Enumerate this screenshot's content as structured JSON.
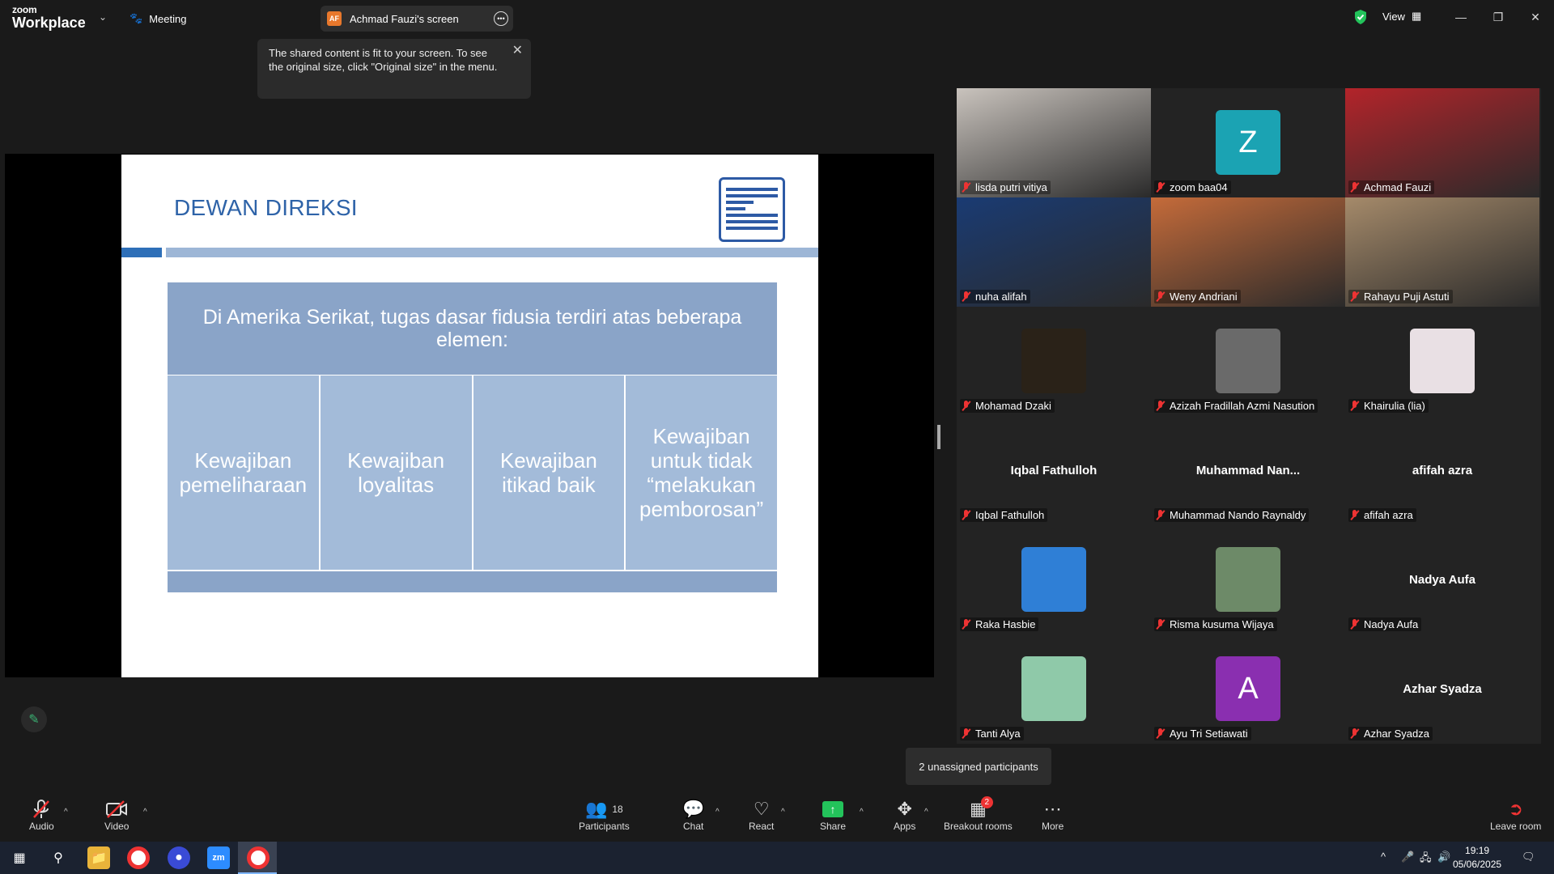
{
  "topbar": {
    "logo_small": "zoom",
    "logo_big": "Workplace",
    "meeting_label": "Meeting",
    "screen_badge": "AF",
    "screen_label": "Achmad Fauzi's screen",
    "view_label": "View"
  },
  "tooltip": {
    "text": "The shared content is fit to your screen. To see the original size, click \"Original size\" in the menu."
  },
  "slide": {
    "title": "DEWAN DIREKSI",
    "heading": "Di Amerika Serikat, tugas dasar fidusia terdiri atas beberapa elemen:",
    "columns": [
      "Kewajiban pemeliharaan",
      "Kewajiban loyalitas",
      "Kewajiban itikad baik",
      "Kewajiban untuk tidak “melakukan pemborosan”"
    ]
  },
  "gallery": {
    "participants": [
      {
        "name": "lisda putri vitiya",
        "type": "photo",
        "color": "#c9c3bd"
      },
      {
        "name": "zoom baa04",
        "type": "avatar",
        "initial": "Z",
        "color": "#1ba3b3"
      },
      {
        "name": "Achmad Fauzi",
        "type": "photo",
        "color": "#b3242a",
        "active": true
      },
      {
        "name": "nuha alifah",
        "type": "photo",
        "color": "#1a3b73"
      },
      {
        "name": "Weny Andriani",
        "type": "photo",
        "color": "#c56b3a"
      },
      {
        "name": "Rahayu Puji Astuti",
        "type": "photo",
        "color": "#a58a6a"
      },
      {
        "name": "Mohamad Dzaki",
        "type": "avatar-photo",
        "color": "#2a2218"
      },
      {
        "name": "Azizah Fradillah Azmi Nasution",
        "type": "avatar-photo",
        "color": "#6a6a6a"
      },
      {
        "name": "Khairulia (lia)",
        "type": "avatar-photo",
        "color": "#e9e0e4"
      },
      {
        "name": "Iqbal Fathulloh",
        "type": "name",
        "display": "Iqbal Fathulloh"
      },
      {
        "name": "Muhammad Nando Raynaldy",
        "type": "name",
        "display": "Muhammad  Nan..."
      },
      {
        "name": "afifah azra",
        "type": "name",
        "display": "afifah azra"
      },
      {
        "name": "Raka Hasbie",
        "type": "avatar-photo",
        "color": "#2f7fd6"
      },
      {
        "name": "Risma kusuma Wijaya",
        "type": "avatar-photo",
        "color": "#6d8a68"
      },
      {
        "name": "Nadya Aufa",
        "type": "name",
        "display": "Nadya Aufa"
      },
      {
        "name": "Tanti Alya",
        "type": "avatar-photo",
        "color": "#8fc9a9"
      },
      {
        "name": "Ayu Tri Setiawati",
        "type": "avatar",
        "initial": "A",
        "color": "#8a2fb0"
      },
      {
        "name": "Azhar Syadza",
        "type": "name",
        "display": "Azhar Syadza"
      }
    ],
    "unassigned": "2 unassigned participants"
  },
  "toolbar": {
    "audio": "Audio",
    "video": "Video",
    "participants": "Participants",
    "participants_count": "18",
    "chat": "Chat",
    "react": "React",
    "share": "Share",
    "apps": "Apps",
    "breakout": "Breakout rooms",
    "breakout_badge": "2",
    "more": "More",
    "leave": "Leave room"
  },
  "taskbar": {
    "time": "19:19",
    "date": "05/06/2025"
  }
}
